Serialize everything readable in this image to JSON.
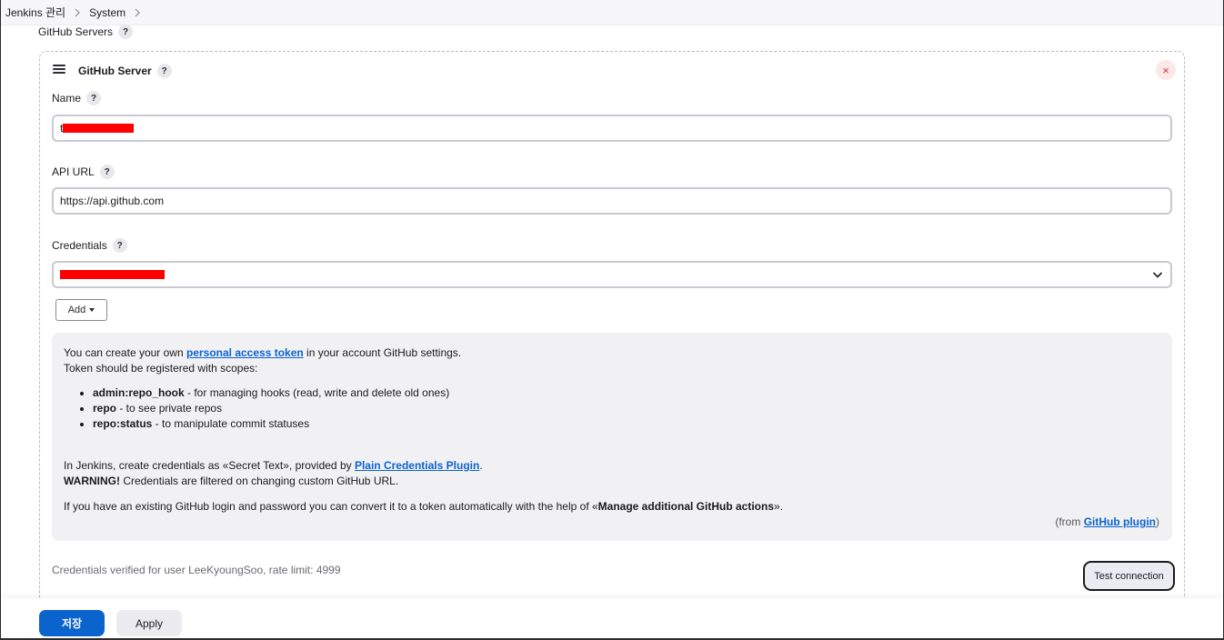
{
  "breadcrumb": {
    "items": [
      "Jenkins 관리",
      "System"
    ]
  },
  "section": {
    "label": "GitHub Servers",
    "help": "?"
  },
  "server": {
    "title": "GitHub Server",
    "help": "?",
    "close": "×",
    "name": {
      "label": "Name",
      "help": "?",
      "value_prefix": "t"
    },
    "api_url": {
      "label": "API URL",
      "help": "?",
      "value": "https://api.github.com"
    },
    "credentials": {
      "label": "Credentials",
      "help": "?",
      "add_label": "Add"
    }
  },
  "help_panel": {
    "line1_pre": "You can create your own ",
    "line1_link": "personal access token",
    "line1_post": " in your account GitHub settings.",
    "line2": "Token should be registered with scopes:",
    "scopes": [
      {
        "name": "admin:repo_hook",
        "desc": " - for managing hooks (read, write and delete old ones)"
      },
      {
        "name": "repo",
        "desc": " - to see private repos"
      },
      {
        "name": "repo:status",
        "desc": " - to manipulate commit statuses"
      }
    ],
    "line3_pre": "In Jenkins, create credentials as «Secret Text», provided by ",
    "line3_link": "Plain Credentials Plugin",
    "line3_post": ".",
    "warning_label": "WARNING!",
    "warning_text": " Credentials are filtered on changing custom GitHub URL.",
    "line5_pre": "If you have an existing GitHub login and password you can convert it to a token automatically with the help of «",
    "line5_bold": "Manage additional GitHub actions",
    "line5_post": "».",
    "from_pre": "(from ",
    "from_link": "GitHub plugin",
    "from_post": ")"
  },
  "status": {
    "verified_text": "Credentials verified for user LeeKyoungSoo, rate limit: 4999"
  },
  "buttons": {
    "test_connection": "Test connection",
    "save": "저장",
    "apply": "Apply"
  },
  "colors": {
    "primary": "#0b63ce",
    "redaction": "#ff0000"
  }
}
